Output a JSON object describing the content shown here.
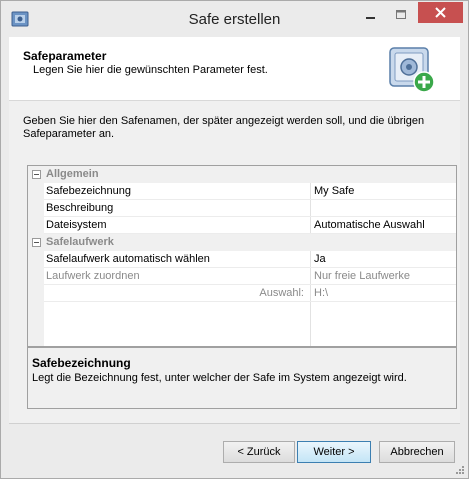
{
  "window": {
    "title": "Safe erstellen"
  },
  "header": {
    "title": "Safeparameter",
    "subtitle": "Legen Sie hier die gewünschten Parameter fest."
  },
  "intro": "Geben Sie hier den Safenamen, der später angezeigt werden soll, und die übrigen Safeparameter an.",
  "grid": {
    "categories": [
      {
        "label": "Allgemein"
      },
      {
        "label": "Safelaufwerk"
      }
    ],
    "rows": [
      {
        "name": "Safebezeichnung",
        "value": "My Safe"
      },
      {
        "name": "Beschreibung",
        "value": ""
      },
      {
        "name": "Dateisystem",
        "value": "Automatische Auswahl"
      },
      {
        "name": "Safelaufwerk automatisch wählen",
        "value": "Ja"
      },
      {
        "name": "Laufwerk zuordnen",
        "value": "Nur freie Laufwerke"
      },
      {
        "name": "Auswahl:",
        "value": "H:\\"
      }
    ]
  },
  "description": {
    "title": "Safebezeichnung",
    "text": "Legt die Bezeichnung fest, unter welcher der Safe im System angezeigt wird."
  },
  "buttons": {
    "back": "< Zurück",
    "next": "Weiter >",
    "cancel": "Abbrechen"
  },
  "colors": {
    "close_button": "#c75050",
    "accent": "#3c7fb1"
  }
}
